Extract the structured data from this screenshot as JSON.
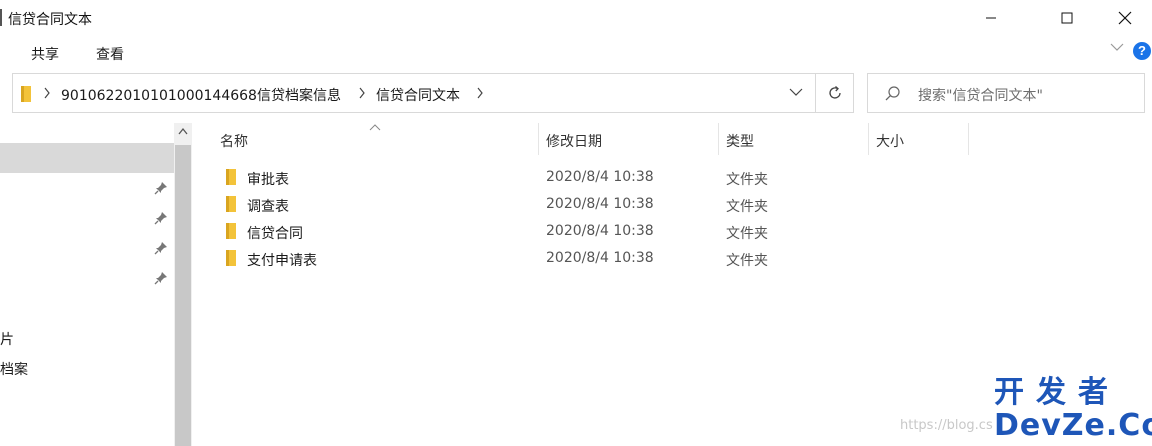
{
  "window": {
    "title": "信贷合同文本"
  },
  "ribbon": {
    "tabs": [
      {
        "label": "共享"
      },
      {
        "label": "查看"
      }
    ],
    "help_label": "?"
  },
  "address": {
    "crumbs": [
      {
        "label": "90106220101010001446​68信贷档案信息"
      },
      {
        "label": "信贷合同文本"
      }
    ]
  },
  "search": {
    "placeholder": "搜索\"信贷合同文本\""
  },
  "nav": {
    "partial_items": [
      {
        "label": "图片"
      },
      {
        "label": "子档案"
      }
    ]
  },
  "columns": {
    "name": "名称",
    "modified": "修改日期",
    "type": "类型",
    "size": "大小"
  },
  "files": [
    {
      "name": "审批表",
      "modified": "2020/8/4 10:38",
      "type": "文件夹"
    },
    {
      "name": "调查表",
      "modified": "2020/8/4 10:38",
      "type": "文件夹"
    },
    {
      "name": "信贷合同",
      "modified": "2020/8/4 10:38",
      "type": "文件夹"
    },
    {
      "name": "支付申请表",
      "modified": "2020/8/4 10:38",
      "type": "文件夹"
    }
  ],
  "watermark": {
    "url": "https://blog.cs",
    "logo_top": "开发者",
    "logo_bottom": "DevZe.CoM"
  },
  "colors": {
    "folder": "#f3c33a",
    "accent": "#1a73e8",
    "logo": "#1e56b8"
  }
}
